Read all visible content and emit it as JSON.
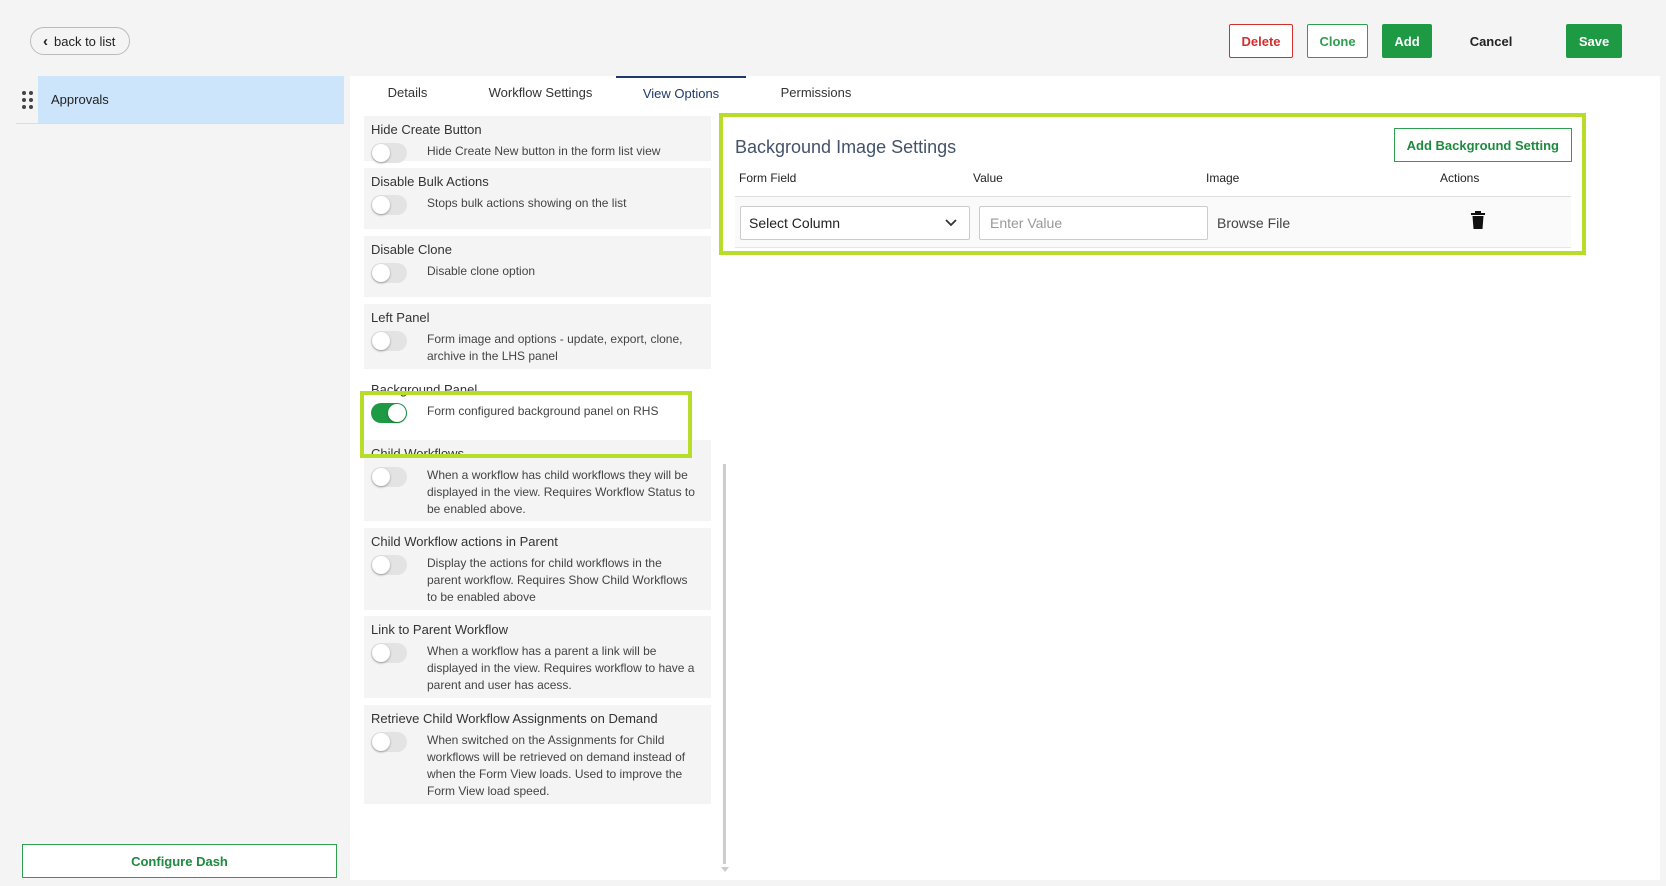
{
  "header": {
    "back_label": "back to list",
    "delete_label": "Delete",
    "clone_label": "Clone",
    "add_label": "Add",
    "cancel_label": "Cancel",
    "save_label": "Save"
  },
  "sidebar": {
    "items": [
      {
        "label": "Approvals",
        "selected": true
      }
    ],
    "configure_label": "Configure Dash"
  },
  "tabs": [
    {
      "label": "Details",
      "active": false
    },
    {
      "label": "Workflow Settings",
      "active": false
    },
    {
      "label": "View Options",
      "active": true
    },
    {
      "label": "Permissions",
      "active": false
    }
  ],
  "options": [
    {
      "title": "Hide Create Button",
      "description": "Hide Create New button in the form list view",
      "enabled": false
    },
    {
      "title": "Disable Bulk Actions",
      "description": "Stops bulk actions showing on the list",
      "enabled": false
    },
    {
      "title": "Disable Clone",
      "description": "Disable clone option",
      "enabled": false
    },
    {
      "title": "Left Panel",
      "description": "Form image and options - update, export, clone, archive in the LHS panel",
      "enabled": false
    },
    {
      "title": "Background Panel",
      "description": "Form configured background panel on RHS",
      "enabled": true
    },
    {
      "title": "Child Workflows",
      "description": "When a workflow has child workflows they will be displayed in the view. Requires Workflow Status to be enabled above.",
      "enabled": false
    },
    {
      "title": "Child Workflow actions in Parent",
      "description": "Display the actions for child workflows in the parent workflow. Requires Show Child Workflows to be enabled above",
      "enabled": false
    },
    {
      "title": "Link to Parent Workflow",
      "description": "When a workflow has a parent a link will be displayed in the view. Requires workflow to have a parent and user has acess.",
      "enabled": false
    },
    {
      "title": "Retrieve Child Workflow Assignments on Demand",
      "description": "When switched on the Assignments for Child workflows will be retrieved on demand instead of when the Form View loads. Used to improve the Form View load speed.",
      "enabled": false
    }
  ],
  "background_settings": {
    "title": "Background Image Settings",
    "add_label": "Add Background Setting",
    "columns": [
      "Form Field",
      "Value",
      "Image",
      "Actions"
    ],
    "row": {
      "select_value": "Select Column",
      "value_placeholder": "Enter Value",
      "image_label": "Browse File"
    }
  },
  "colors": {
    "accent_green": "#1e9a45",
    "highlight": "#b8dc2a",
    "delete_red": "#d32f2f",
    "selected_bg": "#cce5fb"
  }
}
